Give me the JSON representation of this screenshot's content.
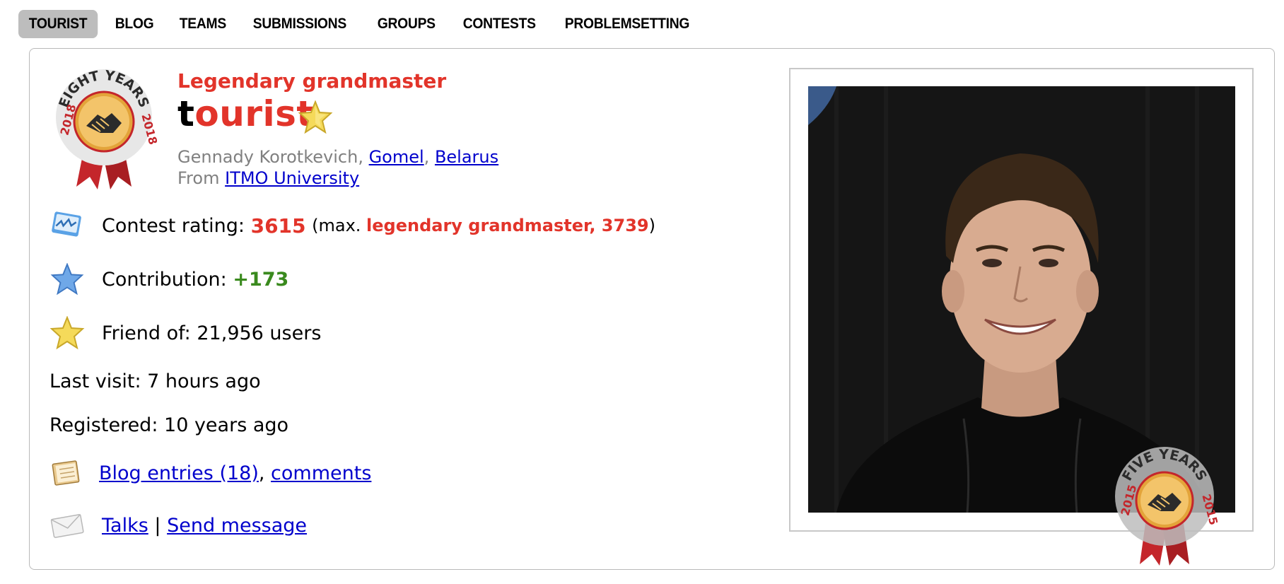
{
  "nav": {
    "items": [
      "TOURIST",
      "BLOG",
      "TEAMS",
      "SUBMISSIONS",
      "GROUPS",
      "CONTESTS",
      "PROBLEMSETTING"
    ],
    "active": "TOURIST"
  },
  "badge_top": {
    "text": "EIGHT YEARS",
    "year_left": "2018",
    "year_right": "2018"
  },
  "profile": {
    "rank": "Legendary grandmaster",
    "handle_first": "t",
    "handle_rest": "ourist",
    "name": "Gennady Korotkevich",
    "city": "Gomel",
    "country": "Belarus",
    "from_label": "From",
    "organization": "ITMO University"
  },
  "stats": {
    "rating_label": "Contest rating:",
    "rating_value": "3615",
    "max_prefix": "(max.",
    "max_value": "legendary grandmaster, 3739",
    "max_suffix": ")",
    "contribution_label": "Contribution:",
    "contribution_value": "+173",
    "friend_label": "Friend of:",
    "friend_value": "21,956 users",
    "last_visit_label": "Last visit:",
    "last_visit_value": "7 hours ago",
    "registered_label": "Registered:",
    "registered_value": "10 years ago"
  },
  "links": {
    "blog_entries": "Blog entries (18)",
    "comments": "comments",
    "talks": "Talks",
    "separator": "|",
    "send_message": "Send message"
  },
  "badge_photo": {
    "text": "FIVE YEARS",
    "year_left": "2015",
    "year_right": "2015"
  },
  "colors": {
    "legendary_red": "#e2342a",
    "contribution_green": "#3a8a1e",
    "link_blue": "#0000cc",
    "nav_active_bg": "#bdbdbd"
  }
}
